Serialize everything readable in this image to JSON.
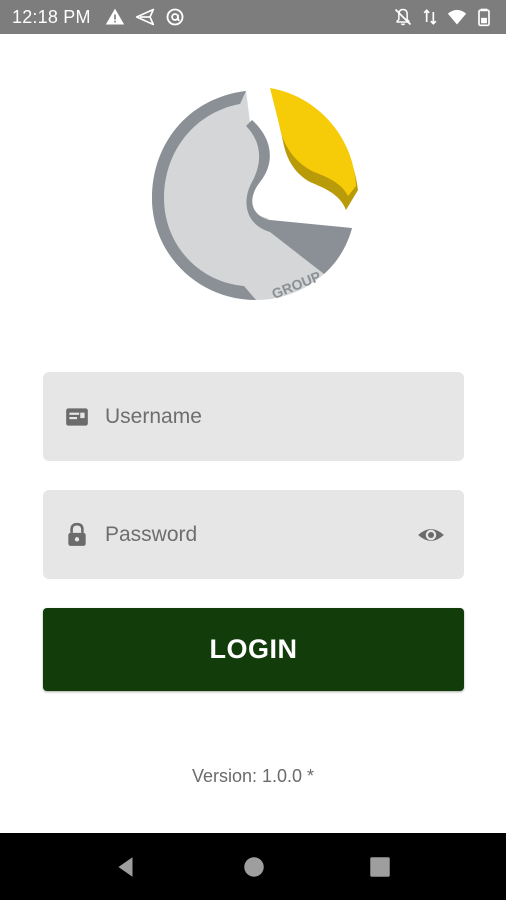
{
  "status_bar": {
    "time": "12:18 PM",
    "left_icons": [
      "warning-icon",
      "send-icon",
      "at-sign-icon"
    ],
    "right_icons": [
      "notifications-off-icon",
      "data-arrows-icon",
      "wifi-icon",
      "battery-icon"
    ]
  },
  "logo": {
    "text": "GROUP",
    "colors": {
      "gray_light": "#d4d6d7",
      "gray_dark": "#8a9095",
      "yellow": "#f6cc08",
      "yellow_dark": "#b99b0a"
    }
  },
  "login_form": {
    "username": {
      "placeholder": "Username",
      "value": "",
      "icon": "id-card-icon"
    },
    "password": {
      "placeholder": "Password",
      "value": "",
      "icon": "lock-icon",
      "toggle_icon": "eye-icon"
    },
    "login_label": "LOGIN"
  },
  "version": "Version: 1.0.0 *",
  "colors": {
    "status_bar_bg": "#7d7d7d",
    "field_bg": "#e6e6e6",
    "button_bg": "#123d0b",
    "nav_bar_bg": "#000000"
  },
  "nav_bar": {
    "buttons": [
      "back-icon",
      "home-icon",
      "recents-icon"
    ]
  }
}
